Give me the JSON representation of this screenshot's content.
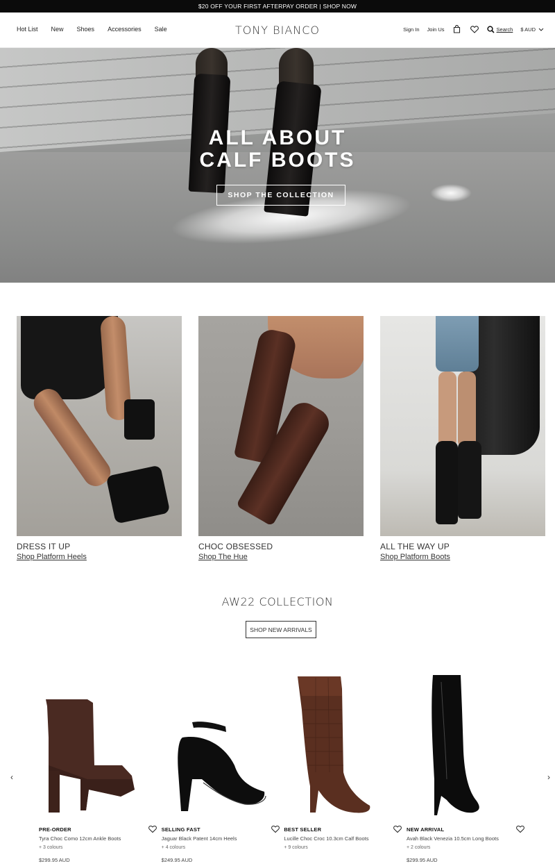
{
  "promo": {
    "text": "$20 OFF YOUR FIRST AFTERPAY ORDER | SHOP NOW"
  },
  "header": {
    "brand": "TONY BIANCO",
    "nav": [
      "Hot List",
      "New",
      "Shoes",
      "Accessories",
      "Sale"
    ],
    "sign_in": "Sign In",
    "join_us": "Join Us",
    "search_label": "Search",
    "currency": "$ AUD",
    "icons": [
      "bag-icon",
      "heart-icon",
      "search-icon",
      "chevron-down-icon"
    ]
  },
  "hero": {
    "title_line1": "ALL ABOUT",
    "title_line2": "CALF BOOTS",
    "cta": "SHOP THE COLLECTION"
  },
  "tiles": [
    {
      "title": "DRESS IT UP",
      "link": "Shop Platform Heels"
    },
    {
      "title": "CHOC OBSESSED",
      "link": "Shop The Hue"
    },
    {
      "title": "ALL THE WAY UP",
      "link": "Shop Platform Boots"
    }
  ],
  "collection": {
    "title": "AW22 COLLECTION",
    "cta": "SHOP NEW ARRIVALS"
  },
  "products": [
    {
      "badge": "PRE-ORDER",
      "name": "Tyra Choc Como 12cm Ankle Boots",
      "colours": "+ 3 colours",
      "price": "$299.95 AUD"
    },
    {
      "badge": "SELLING FAST",
      "name": "Jaguar Black Patent 14cm Heels",
      "colours": "+ 4 colours",
      "price": "$249.95 AUD"
    },
    {
      "badge": "BEST SELLER",
      "name": "Lucille Choc Croc 10.3cm Calf Boots",
      "colours": "+ 9 colours",
      "price": ""
    },
    {
      "badge": "NEW ARRIVAL",
      "name": "Avah Black Venezia 10.5cm Long Boots",
      "colours": "+ 2 colours",
      "price": "$299.95 AUD"
    }
  ],
  "carousel": {
    "prev": "‹",
    "next": "›"
  }
}
